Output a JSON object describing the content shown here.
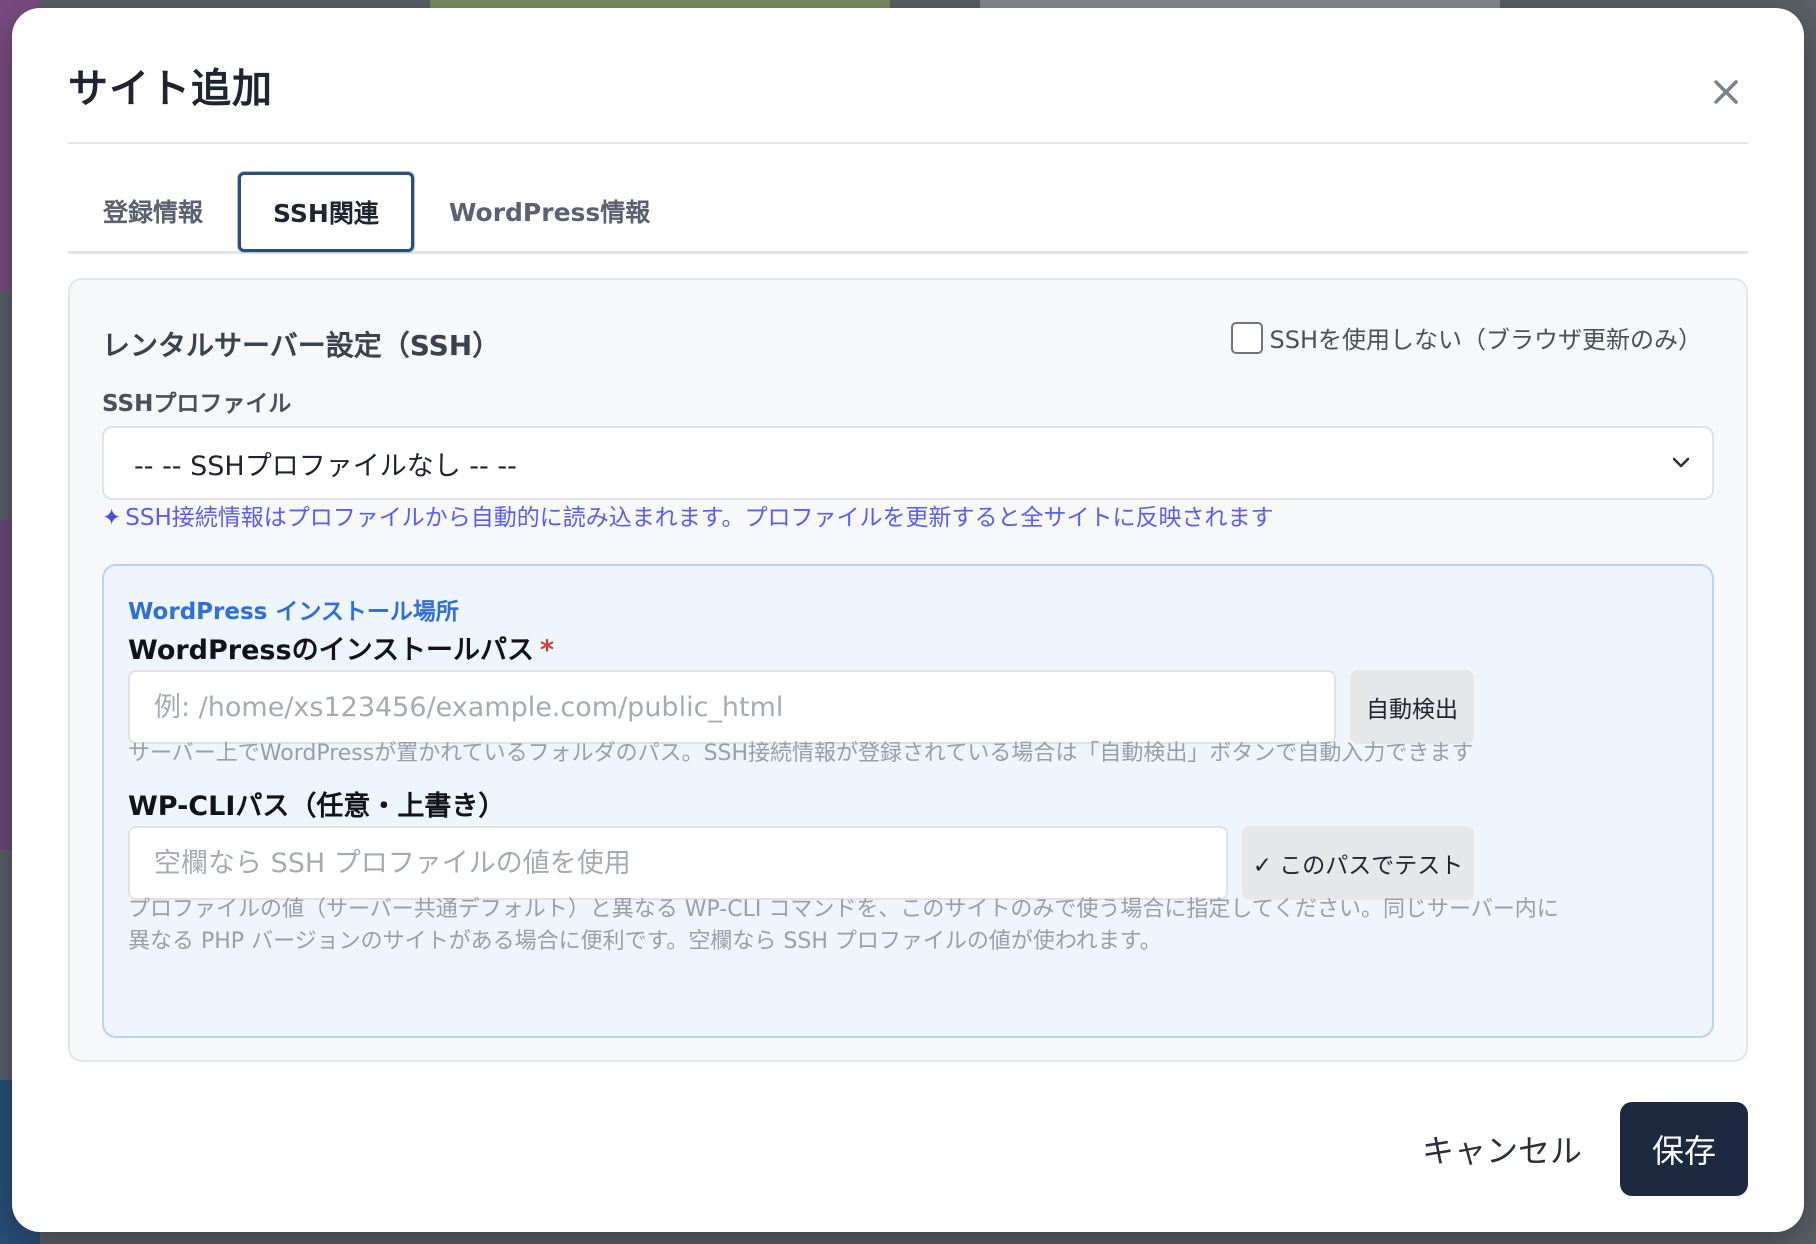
{
  "dialog": {
    "title": "サイト追加",
    "close_icon": "close-icon"
  },
  "tabs": [
    {
      "label": "登録情報",
      "active": false
    },
    {
      "label": "SSH関連",
      "active": true
    },
    {
      "label": "WordPress情報",
      "active": false
    }
  ],
  "ssh_section": {
    "title": "レンタルサーバー設定（SSH）",
    "no_ssh_checkbox_label": "SSHを使用しない（ブラウザ更新のみ）",
    "no_ssh_checked": false,
    "profile_label": "SSHプロファイル",
    "profile_selected": "-- -- SSHプロファイルなし -- --",
    "profile_hint_icon": "sparkle-icon",
    "profile_hint_mark": "✦",
    "profile_hint": "SSH接続情報はプロファイルから自動的に読み込まれます。プロファイルを更新すると全サイトに反映されます"
  },
  "wp_install": {
    "box_title": "WordPress インストール場所",
    "path_label": "WordPressのインストールパス",
    "required_mark": "*",
    "path_value": "",
    "path_placeholder": "例: /home/xs123456/example.com/public_html",
    "autodetect_label": "自動検出",
    "path_help": "サーバー上でWordPressが置かれているフォルダのパス。SSH接続情報が登録されている場合は「自動検出」ボタンで自動入力できます",
    "wpcli_label": "WP-CLIパス（任意・上書き）",
    "wpcli_value": "",
    "wpcli_placeholder": "空欄なら SSH プロファイルの値を使用",
    "test_label": "✓ このパスでテスト",
    "wpcli_help_line1": "プロファイルの値（サーバー共通デフォルト）と異なる WP-CLI コマンドを、このサイトのみで使う場合に指定してください。同じサーバー内に",
    "wpcli_help_line2": "異なる PHP バージョンのサイトがある場合に便利です。空欄なら SSH プロファイルの値が使われます。"
  },
  "footer": {
    "cancel_label": "キャンセル",
    "save_label": "保存"
  },
  "colors": {
    "save_bg": "#1d2940",
    "active_tab_border": "#2b4d7d",
    "hint_purple": "#5a5ef0",
    "wp_box_bg": "#eef5fd",
    "wp_title_blue": "#2f6fd6",
    "required_red": "#d43a3a"
  }
}
